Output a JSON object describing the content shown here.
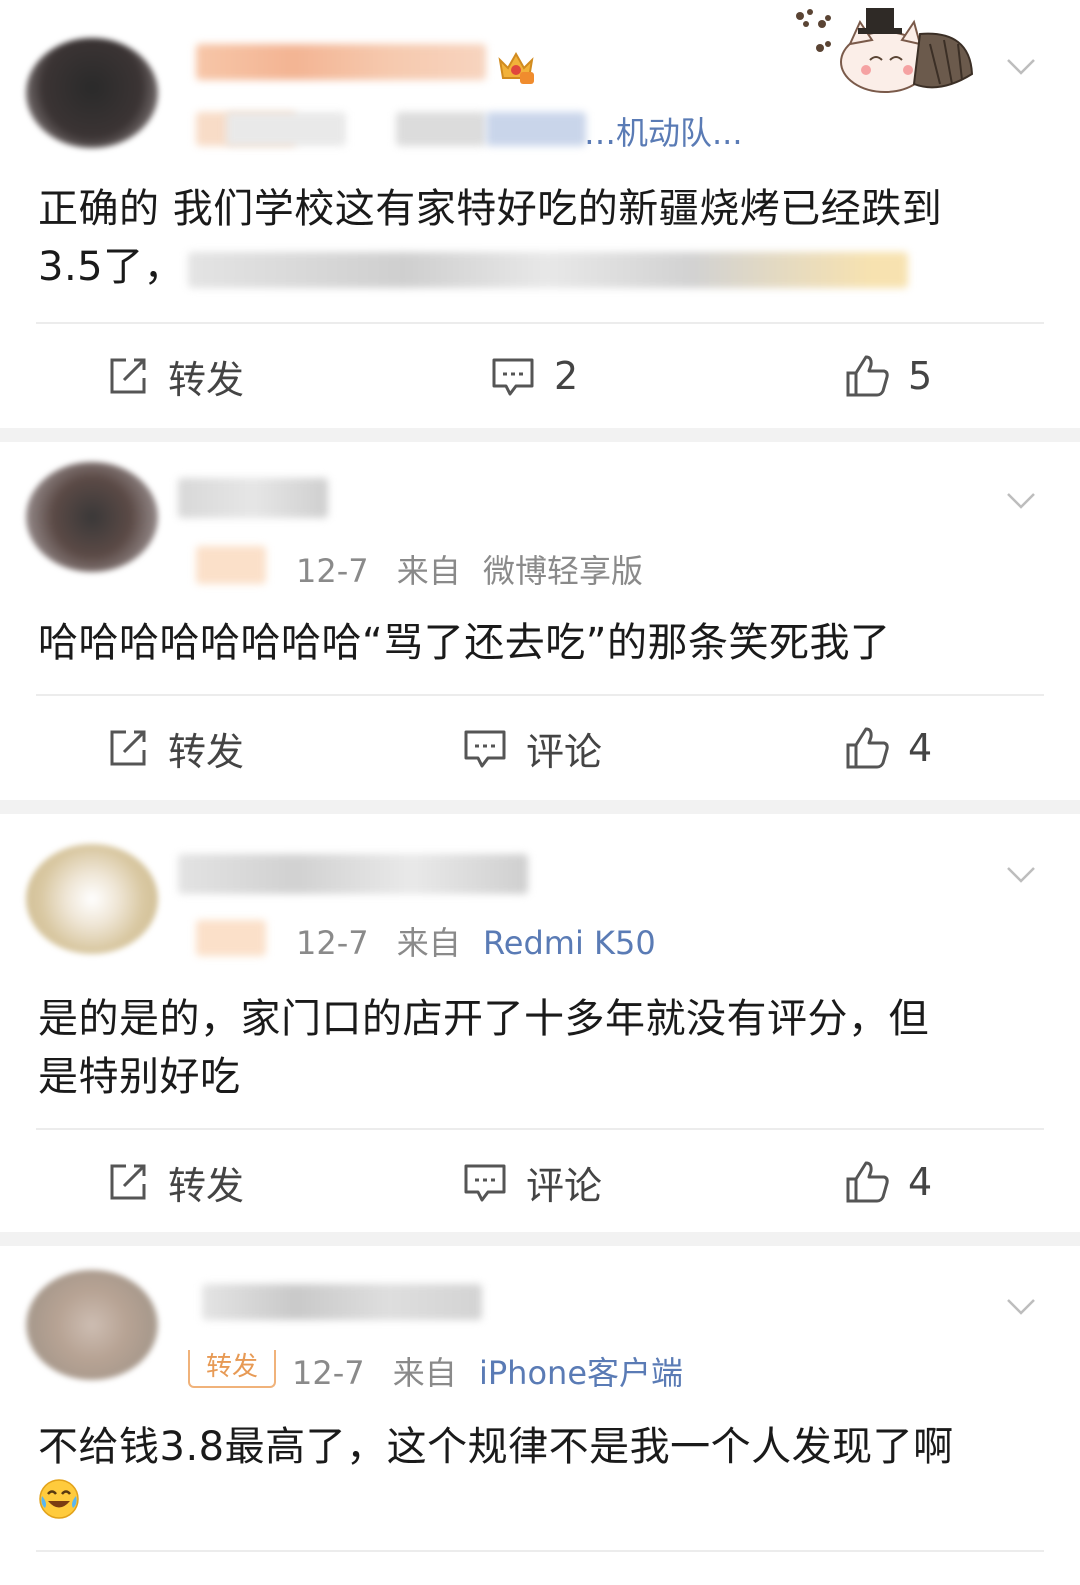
{
  "posts": [
    {
      "source_text": "…机动队...",
      "content_line1": "正确的 我们学校这有家特好吃的新疆烧烤已经跌到",
      "content_line2": "3.5了，",
      "actions": {
        "repost": "转发",
        "comment": "2",
        "like": "5"
      }
    },
    {
      "date": "12-7",
      "from_label": "来自",
      "source": "微博轻享版",
      "content": "哈哈哈哈哈哈哈哈“骂了还去吃”的那条笑死我了",
      "actions": {
        "repost": "转发",
        "comment": "评论",
        "like": "4"
      }
    },
    {
      "date": "12-7",
      "from_label": "来自",
      "source": "Redmi K50",
      "content_line1": "是的是的，家门口的店开了十多年就没有评分，但",
      "content_line2": "是特别好吃",
      "actions": {
        "repost": "转发",
        "comment": "评论",
        "like": "4"
      }
    },
    {
      "badge": "转发",
      "date": "12-7",
      "from_label": "来自",
      "source": "iPhone客户端",
      "content_line1": "不给钱3.8最高了，这个规律不是我一个人发现了啊",
      "actions": {}
    }
  ],
  "icons": {
    "repost": "repost-icon",
    "comment": "comment-icon",
    "like": "thumbs-up-icon",
    "more": "chevron-down-icon",
    "crown": "crown-badge-icon",
    "emoji": "laughing-crying-emoji-icon"
  },
  "colors": {
    "link": "#5a7bb5",
    "meta": "#8a8a8a",
    "separator": "#f2f2f2"
  }
}
